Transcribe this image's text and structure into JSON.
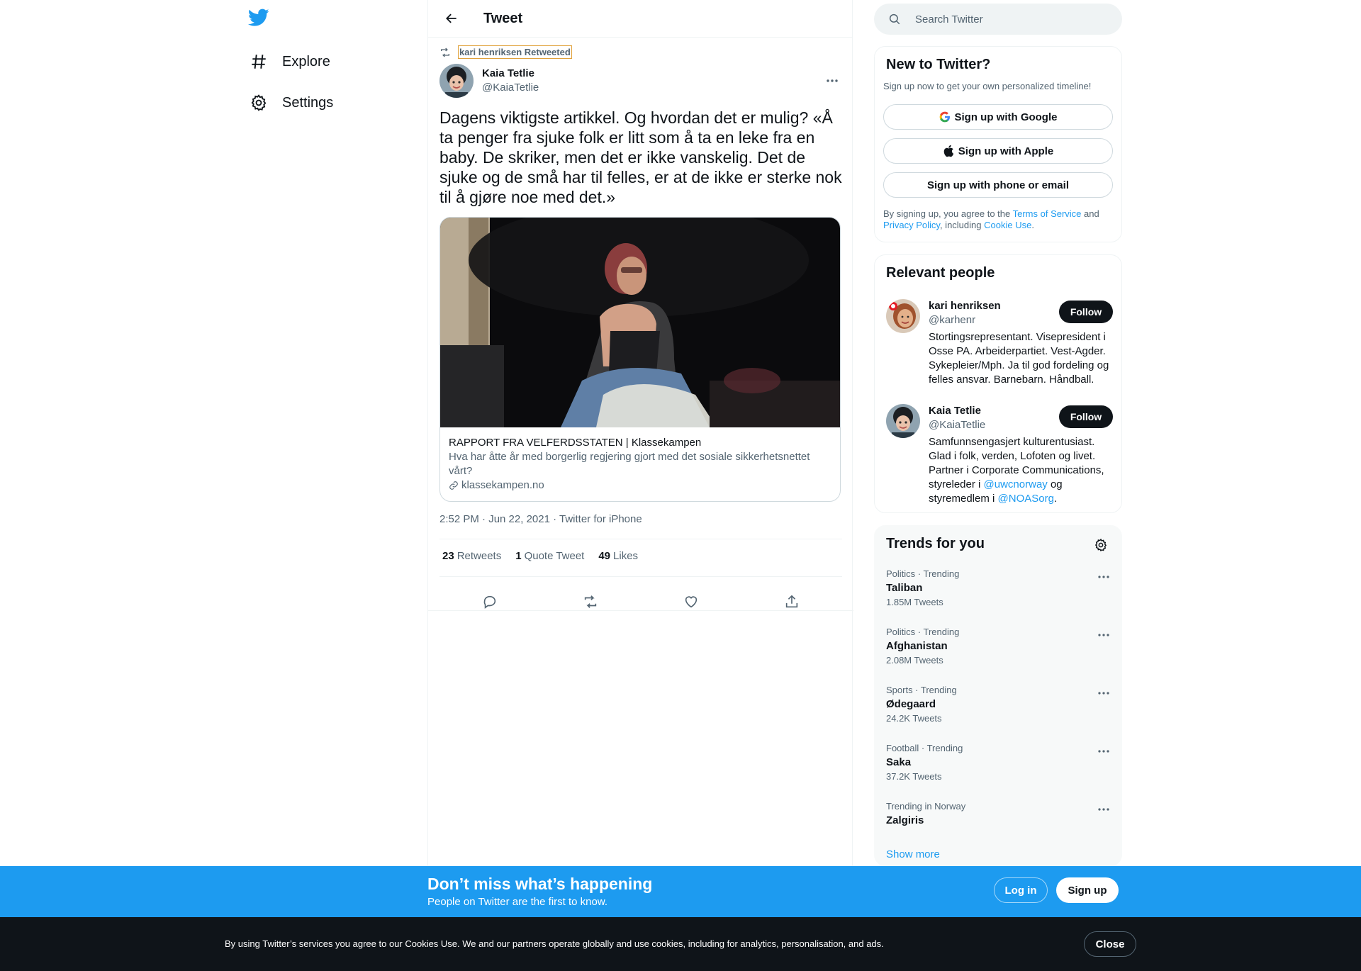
{
  "nav": {
    "logo_icon": "twitter-bird-icon",
    "items": [
      {
        "label": "Explore",
        "icon": "hashtag-icon"
      },
      {
        "label": "Settings",
        "icon": "gear-icon"
      }
    ]
  },
  "header": {
    "title": "Tweet",
    "back_icon": "arrow-left-icon"
  },
  "tweet": {
    "retweeted_by": "kari henriksen Retweeted",
    "author_name": "Kaia Tetlie",
    "author_handle": "@KaiaTetlie",
    "text": "Dagens viktigste artikkel. Og hvordan det er mulig? «Å ta penger fra sjuke folk er litt som å ta en leke fra en baby. De skriker, men det er ikke vanskelig. Det de sjuke og de små har til felles, er at de ikke er sterke nok til å gjøre noe med det.»",
    "card": {
      "title": "RAPPORT FRA VELFERDSSTATEN | Klassekampen",
      "description": "Hva har åtte år med borgerlig regjering gjort med det sosiale sikkerhetsnettet vårt?",
      "domain": "klassekampen.no"
    },
    "timestamp": "2:52 PM · Jun 22, 2021 · Twitter for iPhone",
    "stats": {
      "retweets_count": "23",
      "retweets_label": "Retweets",
      "quotes_count": "1",
      "quotes_label": "Quote Tweet",
      "likes_count": "49",
      "likes_label": "Likes"
    }
  },
  "search": {
    "placeholder": "Search Twitter"
  },
  "new_to_twitter": {
    "title": "New to Twitter?",
    "subtitle": "Sign up now to get your own personalized timeline!",
    "google_label": "Sign up with Google",
    "apple_label": "Sign up with Apple",
    "phone_label": "Sign up with phone or email",
    "terms_prefix": "By signing up, you agree to the ",
    "terms_link": "Terms of Service",
    "terms_and": " and ",
    "privacy_link": "Privacy Policy",
    "terms_including": ", including ",
    "cookie_link": "Cookie Use",
    "terms_end": "."
  },
  "relevant_people": {
    "title": "Relevant people",
    "people": [
      {
        "name": "kari henriksen",
        "handle": "@karhenr",
        "follow_label": "Follow",
        "bio": "Stortingsrepresentant. Visepresident i Osse PA. Arbeiderpartiet. Vest-Agder. Sykepleier/Mph. Ja til god fordeling og felles ansvar. Barnebarn. Håndball."
      },
      {
        "name": "Kaia Tetlie",
        "handle": "@KaiaTetlie",
        "follow_label": "Follow",
        "bio_part1": "Samfunnsengasjert kulturentusiast. Glad i folk, verden, Lofoten og livet. Partner i Corporate Communications, styreleder i ",
        "bio_link1": "@uwcnorway",
        "bio_part2": " og styremedlem i ",
        "bio_link2": "@NOASorg",
        "bio_part3": "."
      }
    ]
  },
  "trends": {
    "title": "Trends for you",
    "items": [
      {
        "meta": "Politics · Trending",
        "name": "Taliban",
        "count": "1.85M Tweets"
      },
      {
        "meta": "Politics · Trending",
        "name": "Afghanistan",
        "count": "2.08M Tweets"
      },
      {
        "meta": "Sports · Trending",
        "name": "Ødegaard",
        "count": "24.2K Tweets"
      },
      {
        "meta": "Football · Trending",
        "name": "Saka",
        "count": "37.2K Tweets"
      },
      {
        "meta": "Trending in Norway",
        "name": "Zalgiris",
        "count": ""
      }
    ],
    "show_more": "Show more"
  },
  "banner": {
    "title": "Don’t miss what’s happening",
    "subtitle": "People on Twitter are the first to know.",
    "login_label": "Log in",
    "signup_label": "Sign up"
  },
  "cookie": {
    "text": "By using Twitter’s services you agree to our Cookies Use. We and our partners operate globally and use cookies, including for analytics, personalisation, and ads.",
    "close_label": "Close"
  },
  "colors": {
    "accent": "#1d9bf0",
    "text": "#0f1419",
    "muted": "#536471",
    "cookie_bg": "#0f1419"
  }
}
